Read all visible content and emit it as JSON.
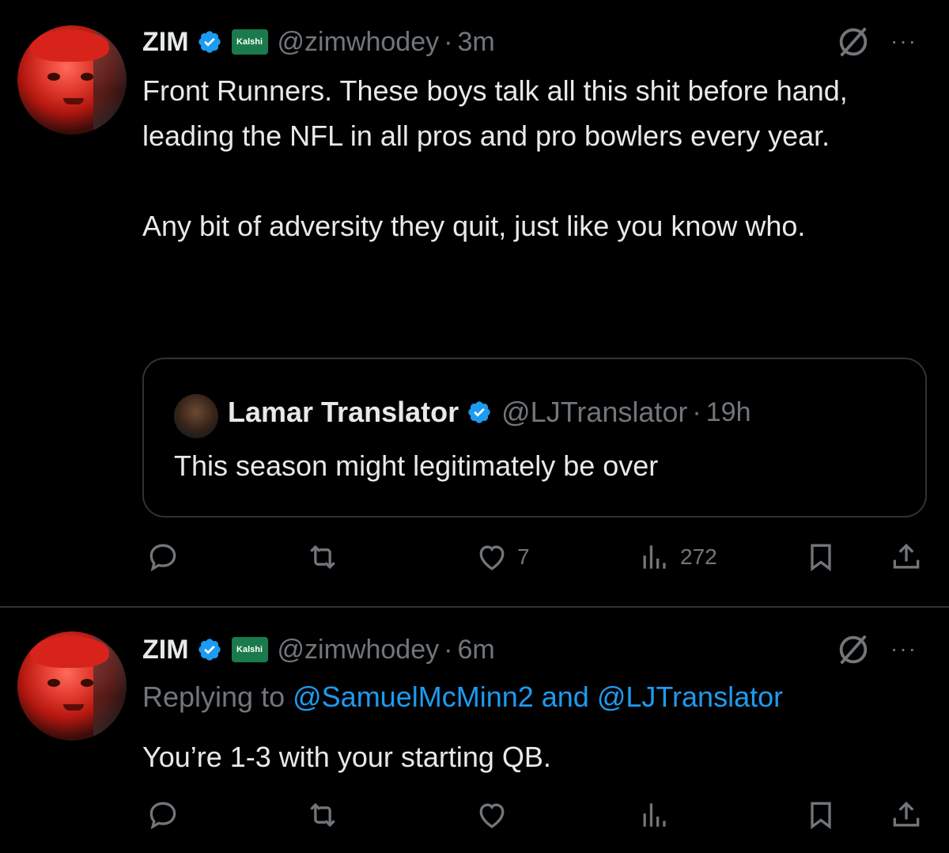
{
  "tweets": [
    {
      "name": "ZIM",
      "badge": "Kalshi",
      "handle": "@zimwhodey",
      "separator": "·",
      "time": "3m",
      "more": "···",
      "text": "Front Runners. These boys talk all this shit before hand, leading the NFL in all pros and pro bowlers every year.\n\nAny bit of adversity they quit, just like you know who.",
      "quote": {
        "name": "Lamar Translator",
        "handle": "@LJTranslator",
        "separator": "·",
        "time": "19h",
        "text": "This season might legitimately be over"
      },
      "actions": {
        "likes": "7",
        "views": "272"
      }
    },
    {
      "name": "ZIM",
      "badge": "Kalshi",
      "handle": "@zimwhodey",
      "separator": "·",
      "time": "6m",
      "more": "···",
      "replying_prefix": "Replying to ",
      "replying_mentions": "@SamuelMcMinn2 and @LJTranslator",
      "text": "You’re 1-3 with your starting QB."
    }
  ],
  "colors": {
    "background": "#000000",
    "text": "#e7e9ea",
    "muted": "#71767b",
    "accent": "#1d9bf0",
    "border": "#2f3336"
  },
  "icons": [
    "verified-badge-icon",
    "kalshi-badge-icon",
    "grok-icon",
    "more-icon",
    "reply-icon",
    "retweet-icon",
    "like-icon",
    "views-icon",
    "bookmark-icon",
    "share-icon"
  ]
}
